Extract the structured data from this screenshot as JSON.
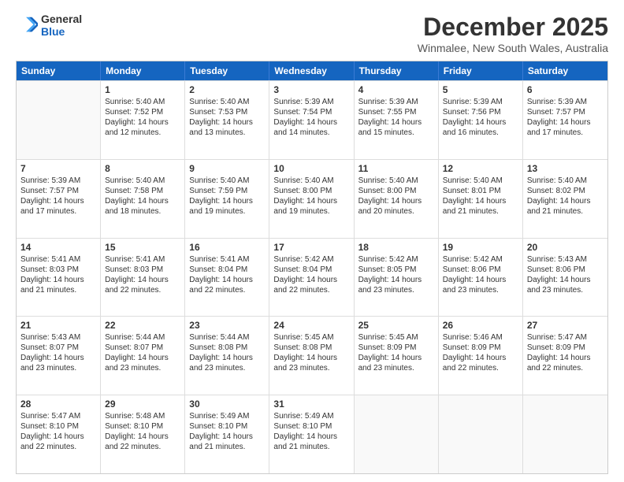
{
  "logo": {
    "line1": "General",
    "line2": "Blue"
  },
  "title": "December 2025",
  "subtitle": "Winmalee, New South Wales, Australia",
  "header_days": [
    "Sunday",
    "Monday",
    "Tuesday",
    "Wednesday",
    "Thursday",
    "Friday",
    "Saturday"
  ],
  "weeks": [
    [
      {
        "day": "",
        "lines": []
      },
      {
        "day": "1",
        "lines": [
          "Sunrise: 5:40 AM",
          "Sunset: 7:52 PM",
          "Daylight: 14 hours",
          "and 12 minutes."
        ]
      },
      {
        "day": "2",
        "lines": [
          "Sunrise: 5:40 AM",
          "Sunset: 7:53 PM",
          "Daylight: 14 hours",
          "and 13 minutes."
        ]
      },
      {
        "day": "3",
        "lines": [
          "Sunrise: 5:39 AM",
          "Sunset: 7:54 PM",
          "Daylight: 14 hours",
          "and 14 minutes."
        ]
      },
      {
        "day": "4",
        "lines": [
          "Sunrise: 5:39 AM",
          "Sunset: 7:55 PM",
          "Daylight: 14 hours",
          "and 15 minutes."
        ]
      },
      {
        "day": "5",
        "lines": [
          "Sunrise: 5:39 AM",
          "Sunset: 7:56 PM",
          "Daylight: 14 hours",
          "and 16 minutes."
        ]
      },
      {
        "day": "6",
        "lines": [
          "Sunrise: 5:39 AM",
          "Sunset: 7:57 PM",
          "Daylight: 14 hours",
          "and 17 minutes."
        ]
      }
    ],
    [
      {
        "day": "7",
        "lines": [
          "Sunrise: 5:39 AM",
          "Sunset: 7:57 PM",
          "Daylight: 14 hours",
          "and 17 minutes."
        ]
      },
      {
        "day": "8",
        "lines": [
          "Sunrise: 5:40 AM",
          "Sunset: 7:58 PM",
          "Daylight: 14 hours",
          "and 18 minutes."
        ]
      },
      {
        "day": "9",
        "lines": [
          "Sunrise: 5:40 AM",
          "Sunset: 7:59 PM",
          "Daylight: 14 hours",
          "and 19 minutes."
        ]
      },
      {
        "day": "10",
        "lines": [
          "Sunrise: 5:40 AM",
          "Sunset: 8:00 PM",
          "Daylight: 14 hours",
          "and 19 minutes."
        ]
      },
      {
        "day": "11",
        "lines": [
          "Sunrise: 5:40 AM",
          "Sunset: 8:00 PM",
          "Daylight: 14 hours",
          "and 20 minutes."
        ]
      },
      {
        "day": "12",
        "lines": [
          "Sunrise: 5:40 AM",
          "Sunset: 8:01 PM",
          "Daylight: 14 hours",
          "and 21 minutes."
        ]
      },
      {
        "day": "13",
        "lines": [
          "Sunrise: 5:40 AM",
          "Sunset: 8:02 PM",
          "Daylight: 14 hours",
          "and 21 minutes."
        ]
      }
    ],
    [
      {
        "day": "14",
        "lines": [
          "Sunrise: 5:41 AM",
          "Sunset: 8:03 PM",
          "Daylight: 14 hours",
          "and 21 minutes."
        ]
      },
      {
        "day": "15",
        "lines": [
          "Sunrise: 5:41 AM",
          "Sunset: 8:03 PM",
          "Daylight: 14 hours",
          "and 22 minutes."
        ]
      },
      {
        "day": "16",
        "lines": [
          "Sunrise: 5:41 AM",
          "Sunset: 8:04 PM",
          "Daylight: 14 hours",
          "and 22 minutes."
        ]
      },
      {
        "day": "17",
        "lines": [
          "Sunrise: 5:42 AM",
          "Sunset: 8:04 PM",
          "Daylight: 14 hours",
          "and 22 minutes."
        ]
      },
      {
        "day": "18",
        "lines": [
          "Sunrise: 5:42 AM",
          "Sunset: 8:05 PM",
          "Daylight: 14 hours",
          "and 23 minutes."
        ]
      },
      {
        "day": "19",
        "lines": [
          "Sunrise: 5:42 AM",
          "Sunset: 8:06 PM",
          "Daylight: 14 hours",
          "and 23 minutes."
        ]
      },
      {
        "day": "20",
        "lines": [
          "Sunrise: 5:43 AM",
          "Sunset: 8:06 PM",
          "Daylight: 14 hours",
          "and 23 minutes."
        ]
      }
    ],
    [
      {
        "day": "21",
        "lines": [
          "Sunrise: 5:43 AM",
          "Sunset: 8:07 PM",
          "Daylight: 14 hours",
          "and 23 minutes."
        ]
      },
      {
        "day": "22",
        "lines": [
          "Sunrise: 5:44 AM",
          "Sunset: 8:07 PM",
          "Daylight: 14 hours",
          "and 23 minutes."
        ]
      },
      {
        "day": "23",
        "lines": [
          "Sunrise: 5:44 AM",
          "Sunset: 8:08 PM",
          "Daylight: 14 hours",
          "and 23 minutes."
        ]
      },
      {
        "day": "24",
        "lines": [
          "Sunrise: 5:45 AM",
          "Sunset: 8:08 PM",
          "Daylight: 14 hours",
          "and 23 minutes."
        ]
      },
      {
        "day": "25",
        "lines": [
          "Sunrise: 5:45 AM",
          "Sunset: 8:09 PM",
          "Daylight: 14 hours",
          "and 23 minutes."
        ]
      },
      {
        "day": "26",
        "lines": [
          "Sunrise: 5:46 AM",
          "Sunset: 8:09 PM",
          "Daylight: 14 hours",
          "and 22 minutes."
        ]
      },
      {
        "day": "27",
        "lines": [
          "Sunrise: 5:47 AM",
          "Sunset: 8:09 PM",
          "Daylight: 14 hours",
          "and 22 minutes."
        ]
      }
    ],
    [
      {
        "day": "28",
        "lines": [
          "Sunrise: 5:47 AM",
          "Sunset: 8:10 PM",
          "Daylight: 14 hours",
          "and 22 minutes."
        ]
      },
      {
        "day": "29",
        "lines": [
          "Sunrise: 5:48 AM",
          "Sunset: 8:10 PM",
          "Daylight: 14 hours",
          "and 22 minutes."
        ]
      },
      {
        "day": "30",
        "lines": [
          "Sunrise: 5:49 AM",
          "Sunset: 8:10 PM",
          "Daylight: 14 hours",
          "and 21 minutes."
        ]
      },
      {
        "day": "31",
        "lines": [
          "Sunrise: 5:49 AM",
          "Sunset: 8:10 PM",
          "Daylight: 14 hours",
          "and 21 minutes."
        ]
      },
      {
        "day": "",
        "lines": []
      },
      {
        "day": "",
        "lines": []
      },
      {
        "day": "",
        "lines": []
      }
    ]
  ]
}
